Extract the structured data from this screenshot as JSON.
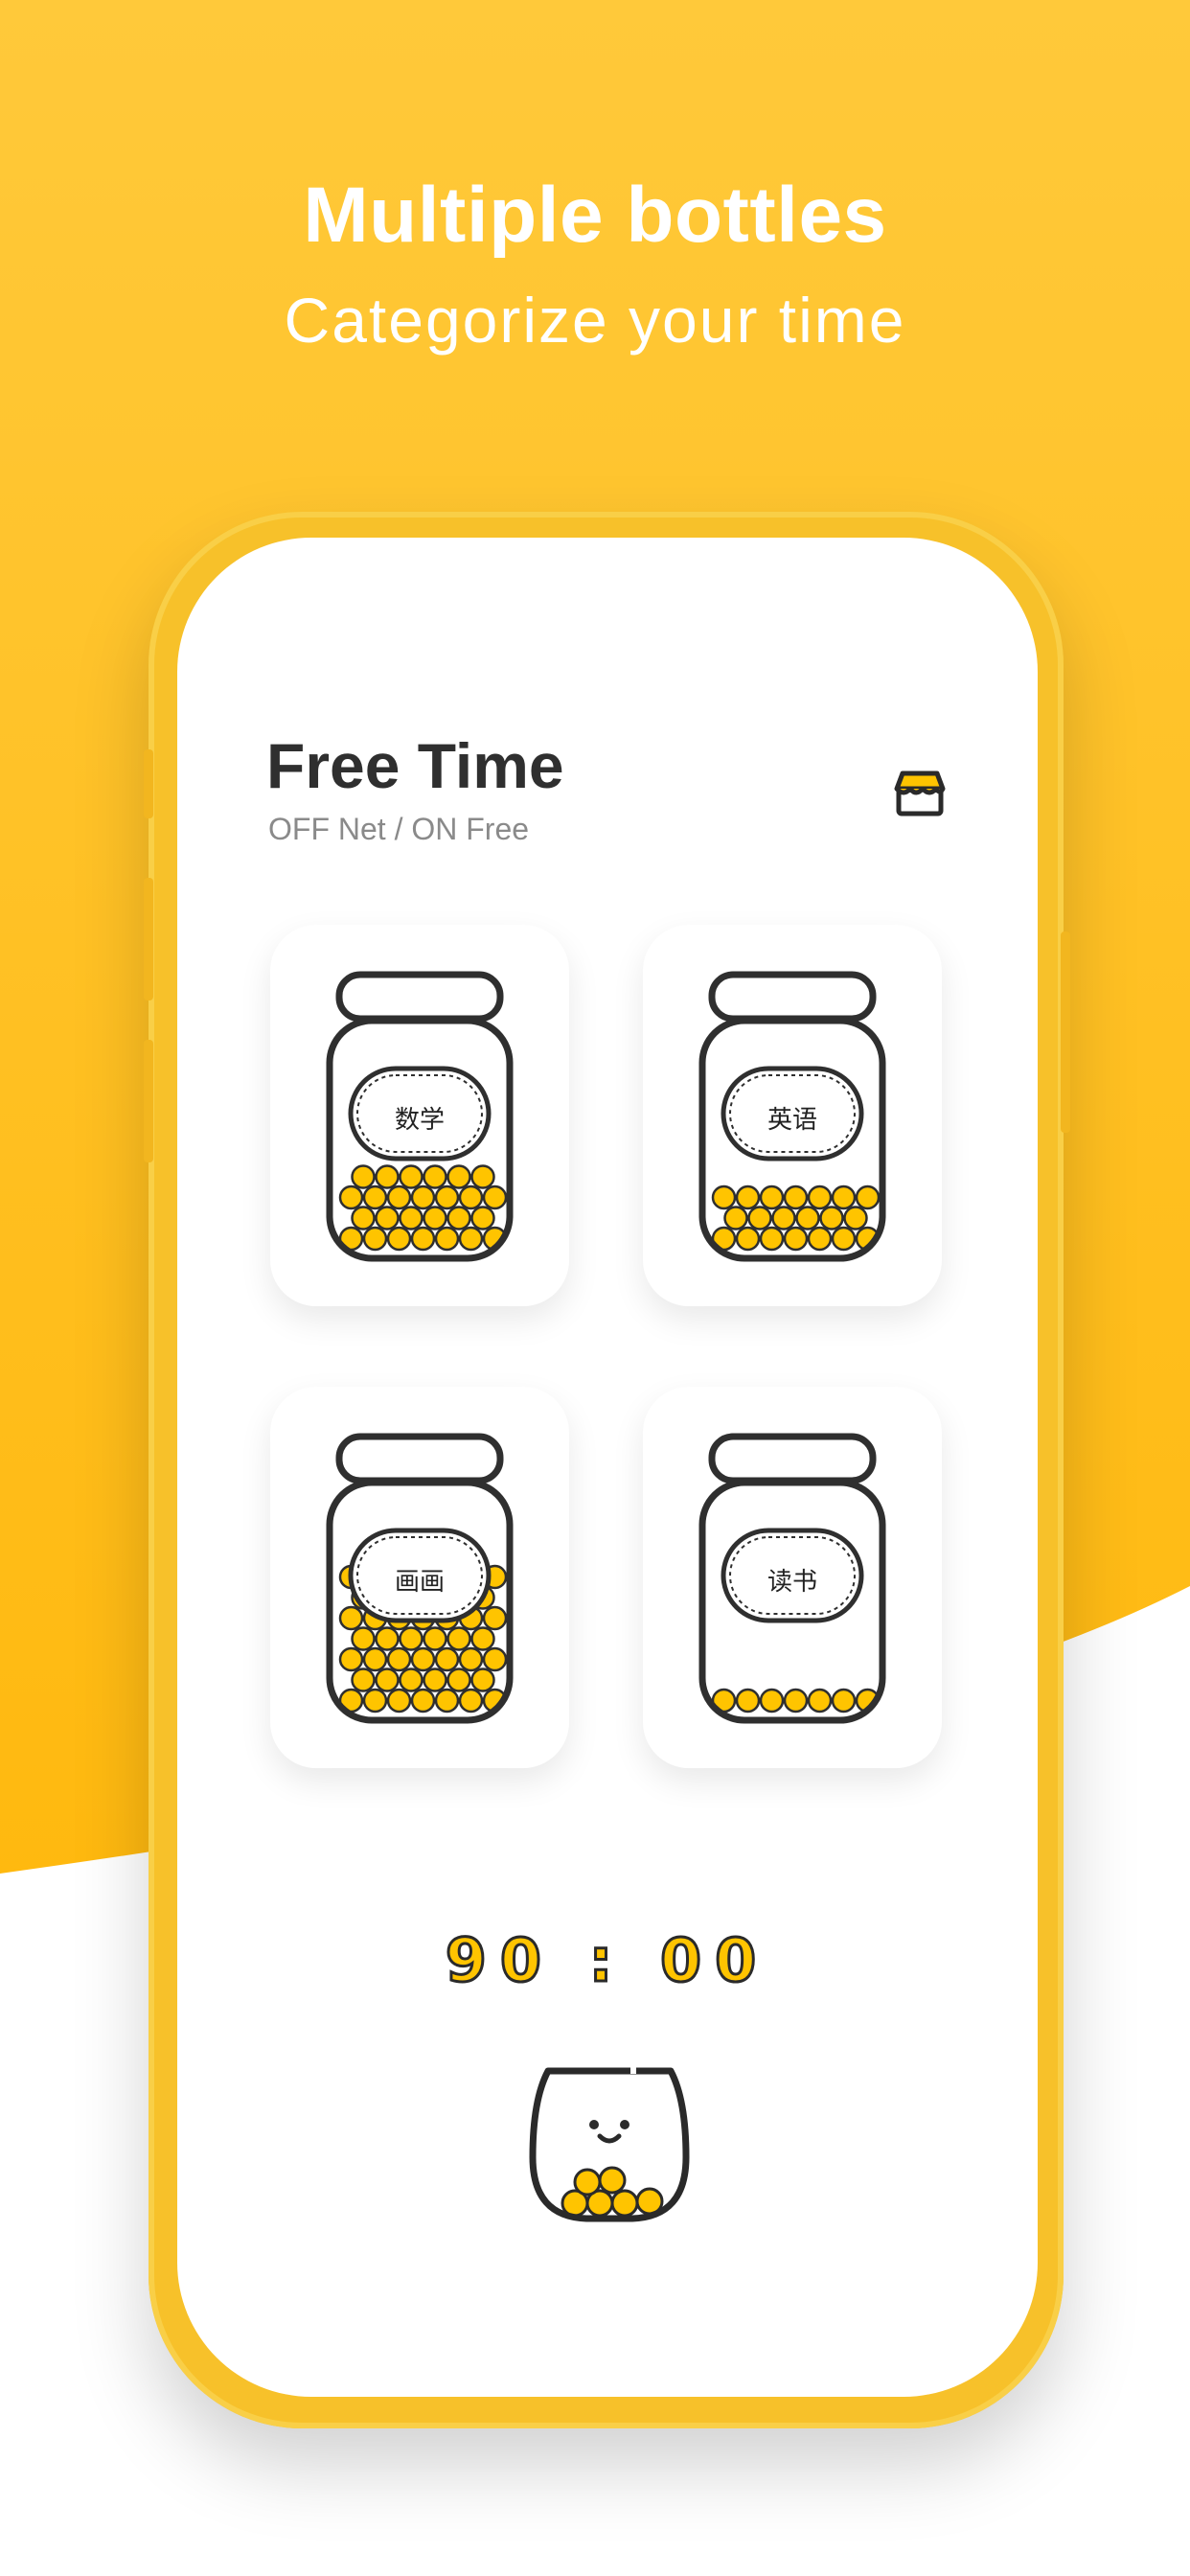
{
  "hero": {
    "title": "Multiple bottles",
    "subtitle": "Categorize your time"
  },
  "colors": {
    "brand_yellow": "#ffc21a",
    "ball_yellow": "#ffc400",
    "ink": "#2f2f2f"
  },
  "app": {
    "title": "Free Time",
    "subtitle": "OFF Net / ON Free",
    "store_icon": "store-icon"
  },
  "bottles": [
    {
      "label": "数学",
      "fill": 0.45
    },
    {
      "label": "英语",
      "fill": 0.3
    },
    {
      "label": "画画",
      "fill": 0.65
    },
    {
      "label": "读书",
      "fill": 0.08
    }
  ],
  "timer": "90 : 00",
  "mascot_icon": "smiling-jar-icon"
}
